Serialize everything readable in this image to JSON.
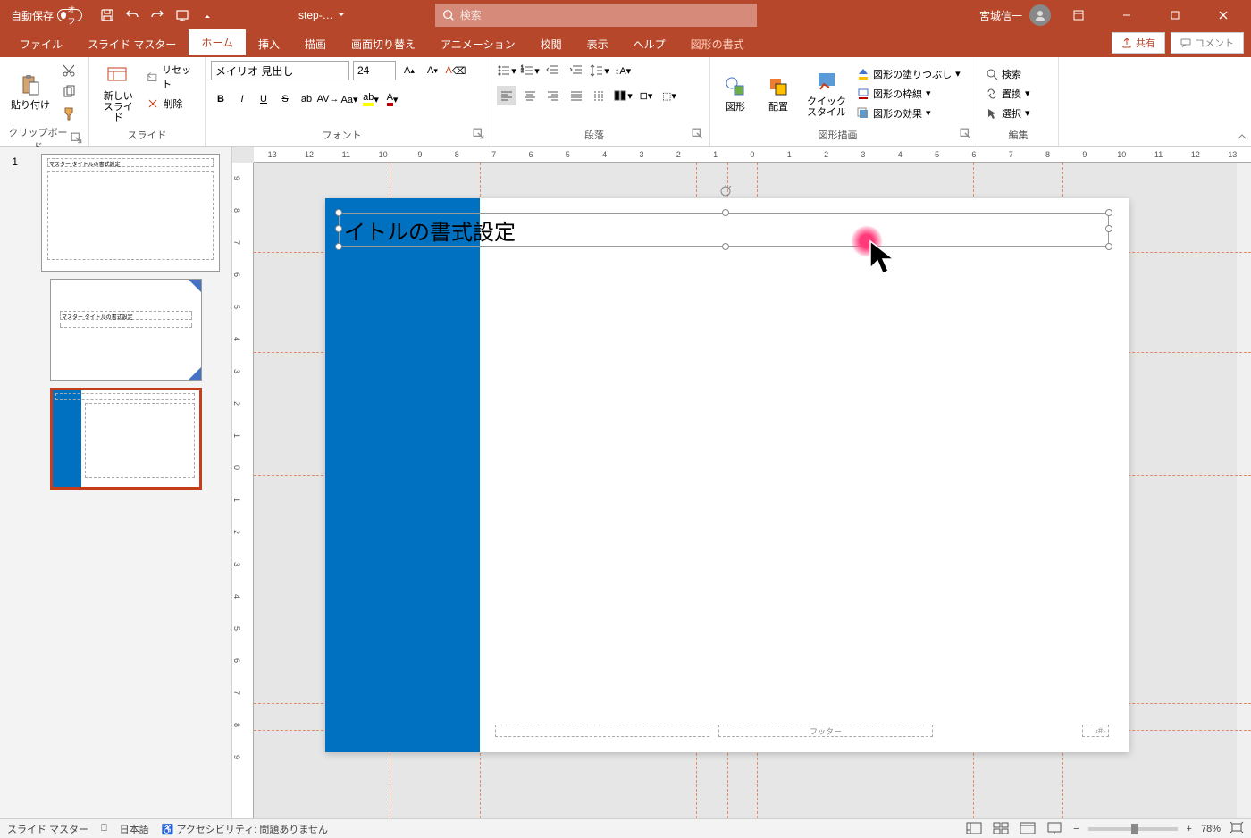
{
  "titlebar": {
    "autosave_label": "自動保存",
    "autosave_state": "オフ",
    "filename": "step-…",
    "search_placeholder": "検索",
    "user_name": "宮城信一"
  },
  "tabs": {
    "file": "ファイル",
    "slidemaster": "スライド マスター",
    "home": "ホーム",
    "insert": "挿入",
    "draw": "描画",
    "transitions": "画面切り替え",
    "animations": "アニメーション",
    "review": "校閲",
    "view": "表示",
    "help": "ヘルプ",
    "shapeformat": "図形の書式",
    "share": "共有",
    "comment": "コメント"
  },
  "ribbon": {
    "clipboard": {
      "label": "クリップボード",
      "paste": "貼り付け"
    },
    "slides": {
      "label": "スライド",
      "new": "新しい\nスライド",
      "reset": "リセット",
      "delete": "削除"
    },
    "font": {
      "label": "フォント",
      "name": "メイリオ 見出し",
      "size": "24"
    },
    "paragraph": {
      "label": "段落"
    },
    "drawing": {
      "label": "図形描画",
      "shapes": "図形",
      "arrange": "配置",
      "quickstyles": "クイック\nスタイル",
      "fill": "図形の塗りつぶし",
      "outline": "図形の枠線",
      "effects": "図形の効果"
    },
    "editing": {
      "label": "編集",
      "find": "検索",
      "replace": "置換",
      "select": "選択"
    }
  },
  "thumbnails": {
    "number": "1",
    "master_title": "マスター タイトルの書式設定",
    "layout_title": "マスター タイトルの書式設定"
  },
  "slide": {
    "title_text": "イトルの書式設定",
    "footer": "フッター",
    "pagenum": "‹#›"
  },
  "ruler_h": [
    "13",
    "12",
    "11",
    "10",
    "9",
    "8",
    "7",
    "6",
    "5",
    "4",
    "3",
    "2",
    "1",
    "0",
    "1",
    "2",
    "3",
    "4",
    "5",
    "6",
    "7",
    "8",
    "9",
    "10",
    "11",
    "12",
    "13"
  ],
  "ruler_v": [
    "9",
    "8",
    "7",
    "6",
    "5",
    "4",
    "3",
    "2",
    "1",
    "0",
    "1",
    "2",
    "3",
    "4",
    "5",
    "6",
    "7",
    "8",
    "9"
  ],
  "statusbar": {
    "view_mode": "スライド マスター",
    "language": "日本語",
    "accessibility": "アクセシビリティ: 問題ありません",
    "zoom": "78%"
  }
}
